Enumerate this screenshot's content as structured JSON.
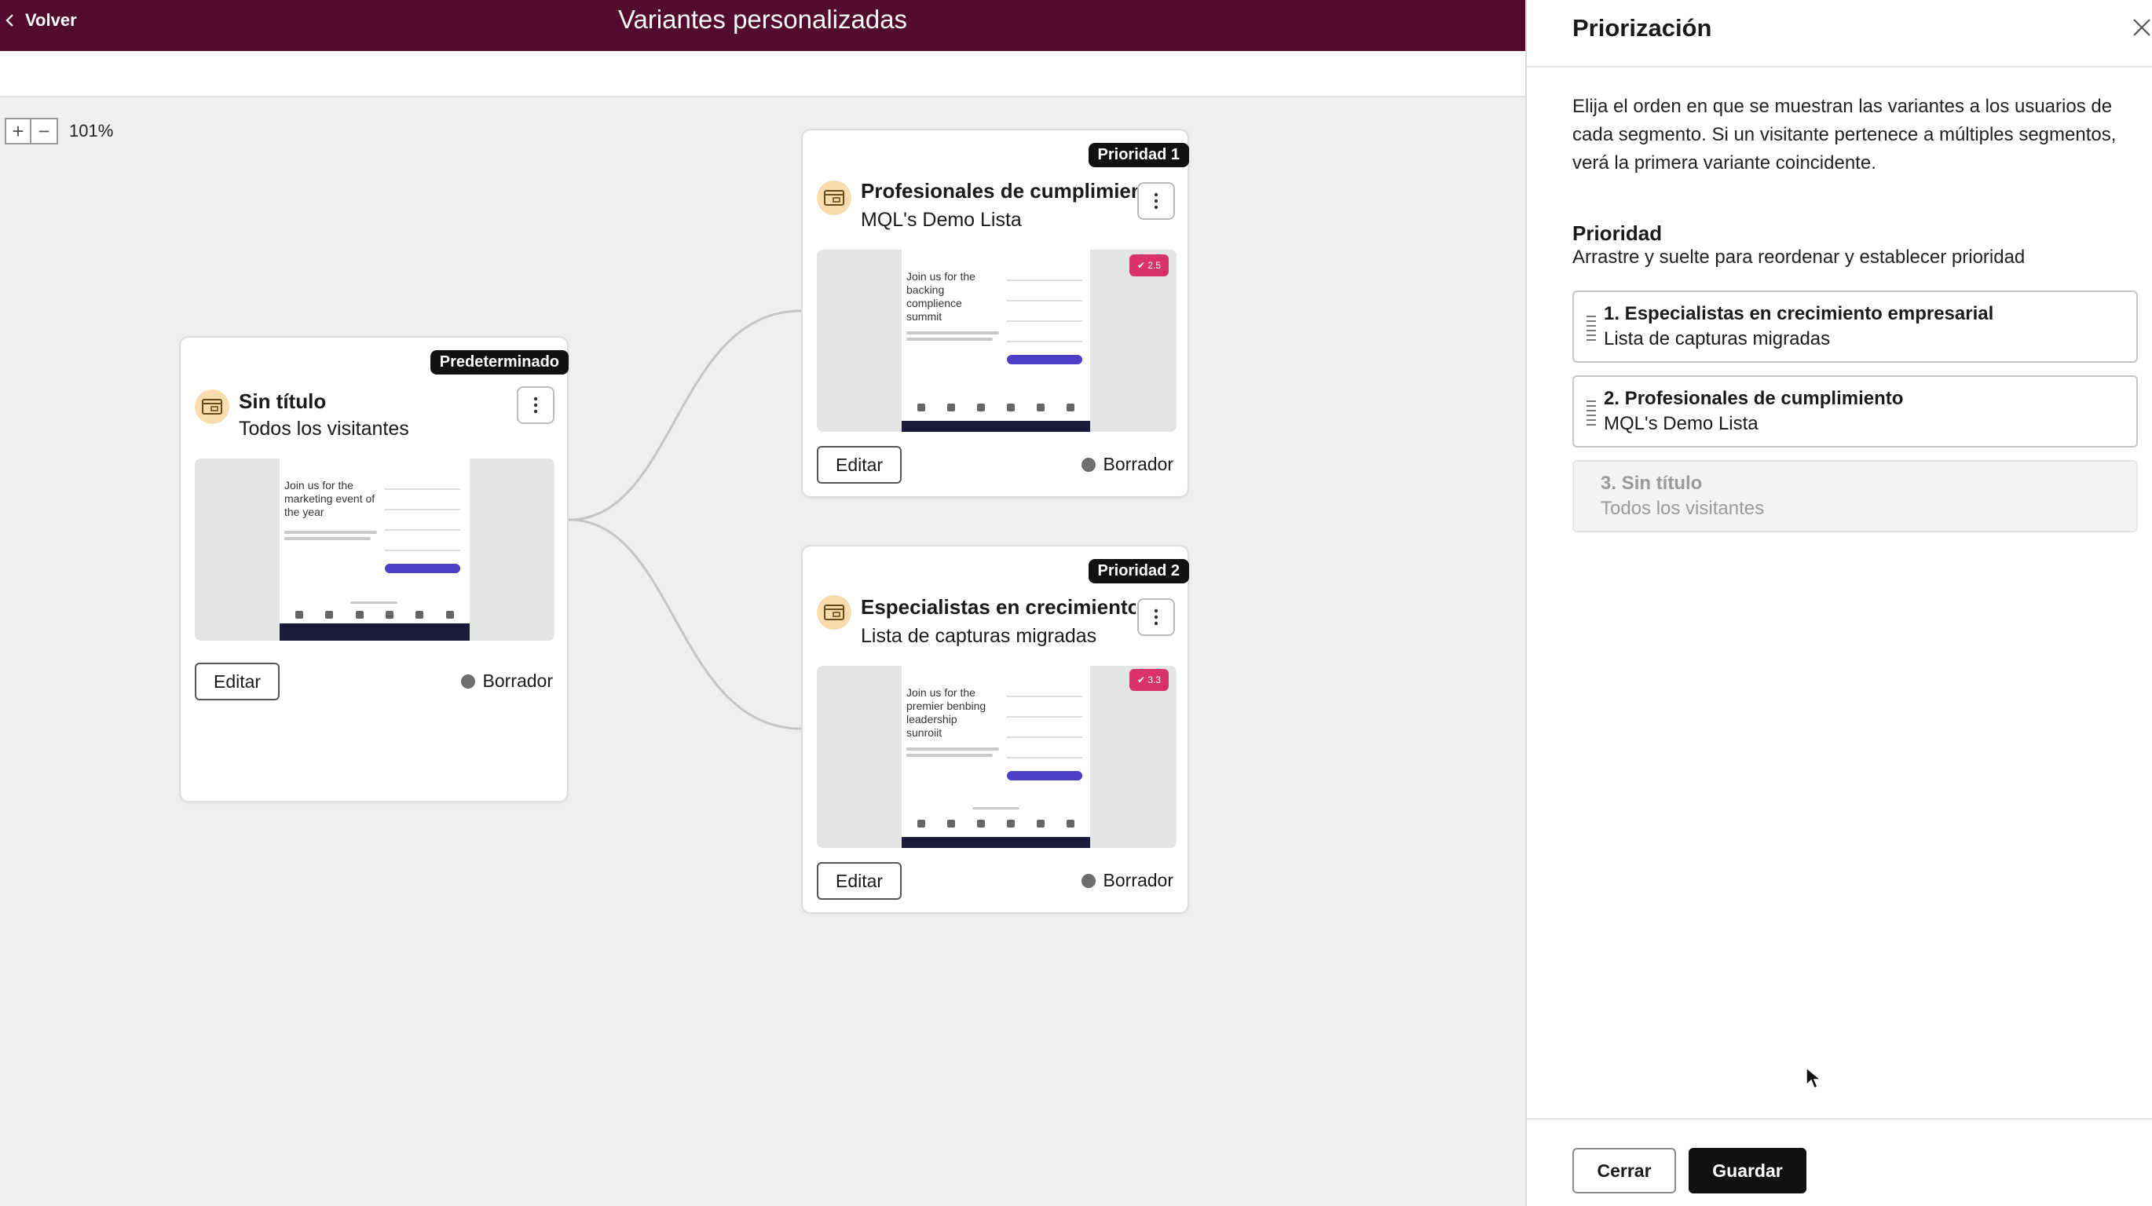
{
  "header": {
    "back_label": "Volver",
    "title": "Variantes personalizadas",
    "bg_color": "#520a2e"
  },
  "zoom": {
    "plus": "+",
    "minus": "−",
    "level": "101%"
  },
  "cards": {
    "default": {
      "badge": "Predeterminado",
      "title": "Sin título",
      "subtitle": "Todos los visitantes",
      "preview_text": "Join us for the marketing event of the year",
      "edit_label": "Editar",
      "status": "Borrador"
    },
    "priority1": {
      "badge": "Prioridad 1",
      "title": "Profesionales de cumplimiento",
      "subtitle": "MQL's Demo Lista",
      "preview_text": "Join us for the backing complience summit",
      "preview_tag": "✔ 2.5",
      "edit_label": "Editar",
      "status": "Borrador"
    },
    "priority2": {
      "badge": "Prioridad 2",
      "title": "Especialistas en crecimiento empresarial",
      "subtitle": "Lista de capturas migradas",
      "preview_text": "Join us for the premier benbing leadership sunroiit",
      "preview_tag": "✔ 3.3",
      "edit_label": "Editar",
      "status": "Borrador"
    }
  },
  "panel": {
    "title": "Priorización",
    "description": "Elija el orden en que se muestran las variantes a los usuarios de cada segmento. Si un visitante pertenece a múltiples segmentos, verá la primera variante coincidente.",
    "priority_label": "Prioridad",
    "priority_hint": "Arrastre y suelte para reordenar y establecer prioridad",
    "items": [
      {
        "title": "1. Especialistas en crecimiento empresarial",
        "subtitle": "Lista de capturas migradas"
      },
      {
        "title": "2. Profesionales de cumplimiento",
        "subtitle": "MQL's Demo Lista"
      },
      {
        "title": "3. Sin título",
        "subtitle": "Todos los visitantes"
      }
    ],
    "close_label": "Cerrar",
    "save_label": "Guardar"
  }
}
